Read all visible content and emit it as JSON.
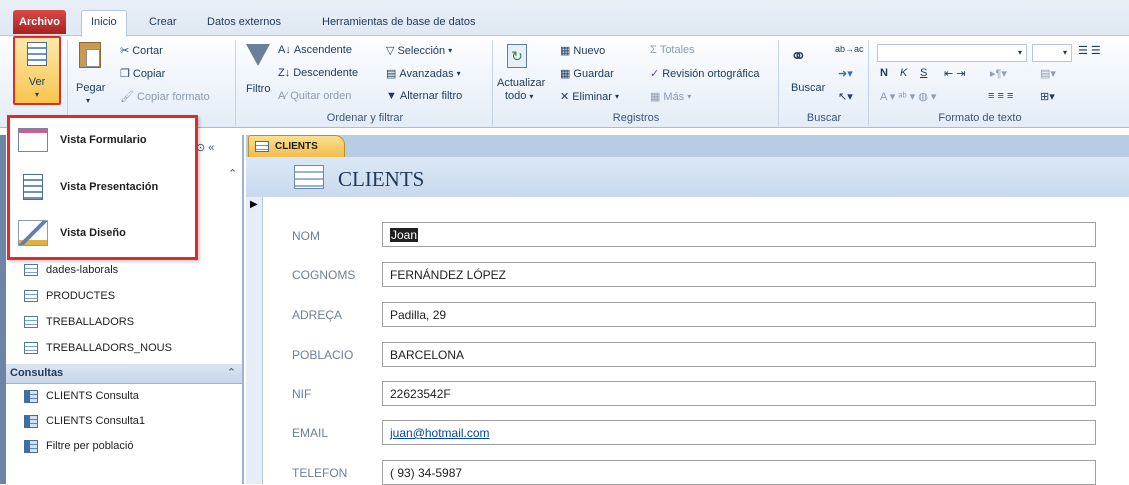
{
  "tabs": [
    "Archivo",
    "Inicio",
    "Crear",
    "Datos externos",
    "Herramientas de base de datos"
  ],
  "ribbon": {
    "views": {
      "ver": "Ver"
    },
    "clipboard": {
      "pegar": "Pegar",
      "cortar": "Cortar",
      "copiar": "Copiar",
      "copiar_formato": "Copiar formato"
    },
    "sort": {
      "filtro": "Filtro",
      "ascendente": "Ascendente",
      "descendente": "Descendente",
      "quitar_orden": "Quitar orden",
      "seleccion": "Selección",
      "avanzadas": "Avanzadas",
      "alternar": "Alternar filtro",
      "group": "Ordenar y filtrar"
    },
    "records": {
      "actualizar_1": "Actualizar",
      "actualizar_2": "todo",
      "nuevo": "Nuevo",
      "guardar": "Guardar",
      "eliminar": "Eliminar",
      "totales": "Totales",
      "revision": "Revisión ortográfica",
      "mas": "Más",
      "group": "Registros"
    },
    "find": {
      "buscar": "Buscar",
      "group": "Buscar"
    },
    "text": {
      "group": "Formato de texto",
      "bold": "N",
      "italic": "K",
      "underline": "S"
    }
  },
  "dropdown": [
    {
      "label": "Vista Formulario"
    },
    {
      "label": "Vista Presentación"
    },
    {
      "label": "Vista Diseño"
    }
  ],
  "nav": {
    "tables": [
      "dades-laborals",
      "PRODUCTES",
      "TREBALLADORS",
      "TREBALLADORS_NOUS"
    ],
    "queries_header": "Consultas",
    "queries": [
      "CLIENTS Consulta",
      "CLIENTS Consulta1",
      "Filtre per població"
    ]
  },
  "doc": {
    "tab": "CLIENTS",
    "title": "CLIENTS"
  },
  "form": {
    "fields": [
      {
        "label": "NOM",
        "value": "Joan"
      },
      {
        "label": "COGNOMS",
        "value": "FERNÁNDEZ LÓPEZ"
      },
      {
        "label": "ADREÇA",
        "value": "Padilla, 29"
      },
      {
        "label": "POBLACIO",
        "value": "BARCELONA"
      },
      {
        "label": "NIF",
        "value": "22623542F"
      },
      {
        "label": "EMAIL",
        "value": "juan@hotmail.com"
      },
      {
        "label": "TELEFON",
        "value": "( 93) 34-5987"
      }
    ]
  },
  "colors": {
    "accent_red": "#e12b2b",
    "ribbon_blue": "#dfe8f3",
    "highlight": "#f7c550"
  }
}
